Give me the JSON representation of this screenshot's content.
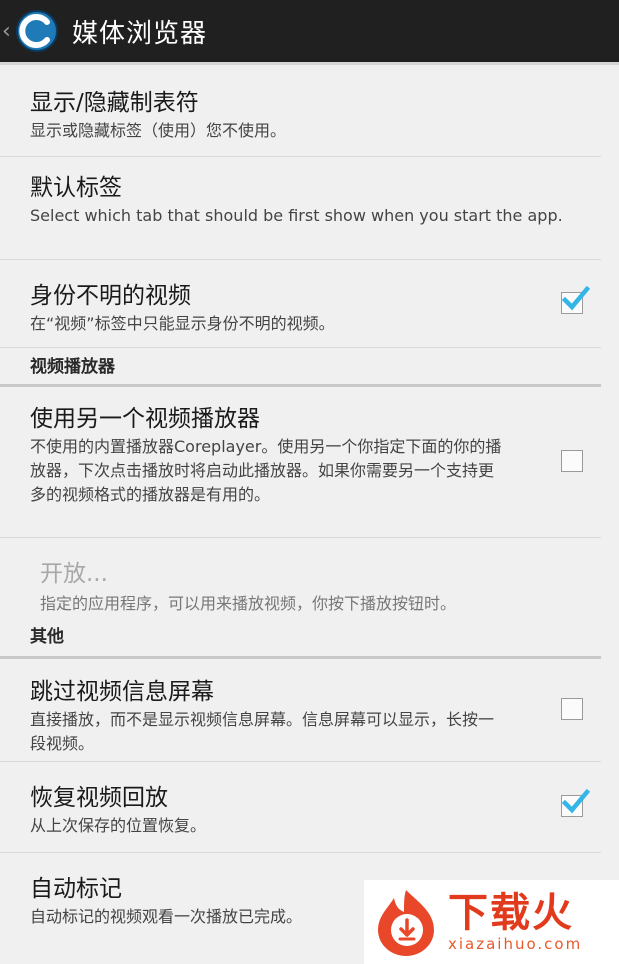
{
  "header": {
    "back_glyph": "‹",
    "title": "媒体浏览器"
  },
  "prefs": {
    "show_hide_tabs": {
      "title": "显示/隐藏制表符",
      "summary": "显示或隐藏标签（使用）您不使用。"
    },
    "default_tab": {
      "title": "默认标签",
      "summary": "Select which tab that should be first show when you start the app."
    },
    "unknown_videos": {
      "title": "身份不明的视频",
      "summary": "在“视频”标签中只能显示身份不明的视频。",
      "checked": true
    },
    "alt_player": {
      "title": "使用另一个视频播放器",
      "summary": "不使用的内置播放器Coreplayer。使用另一个你指定下面的你的播放器，下次点击播放时将启动此播放器。如果你需要另一个支持更多的视频格式的播放器是有用的。",
      "checked": false
    },
    "open": {
      "title": "开放...",
      "summary": "指定的应用程序，可以用来播放视频，你按下播放按钮时。",
      "enabled": false
    },
    "skip_info": {
      "title": "跳过视频信息屏幕",
      "summary": "直接播放，而不是显示视频信息屏幕。信息屏幕可以显示，长按一段视频。",
      "checked": false
    },
    "resume": {
      "title": "恢复视频回放",
      "summary": "从上次保存的位置恢复。",
      "checked": true
    },
    "auto_mark": {
      "title": "自动标记",
      "summary": "自动标记的视频观看一次播放已完成。"
    }
  },
  "categories": {
    "video_player": "视频播放器",
    "other": "其他"
  },
  "watermark": {
    "cn": "下载火",
    "url": "xiazaihuo.com"
  },
  "colors": {
    "actionbar": "#202020",
    "check_blue": "#33b5e5",
    "watermark_red": "#e23a1c"
  }
}
